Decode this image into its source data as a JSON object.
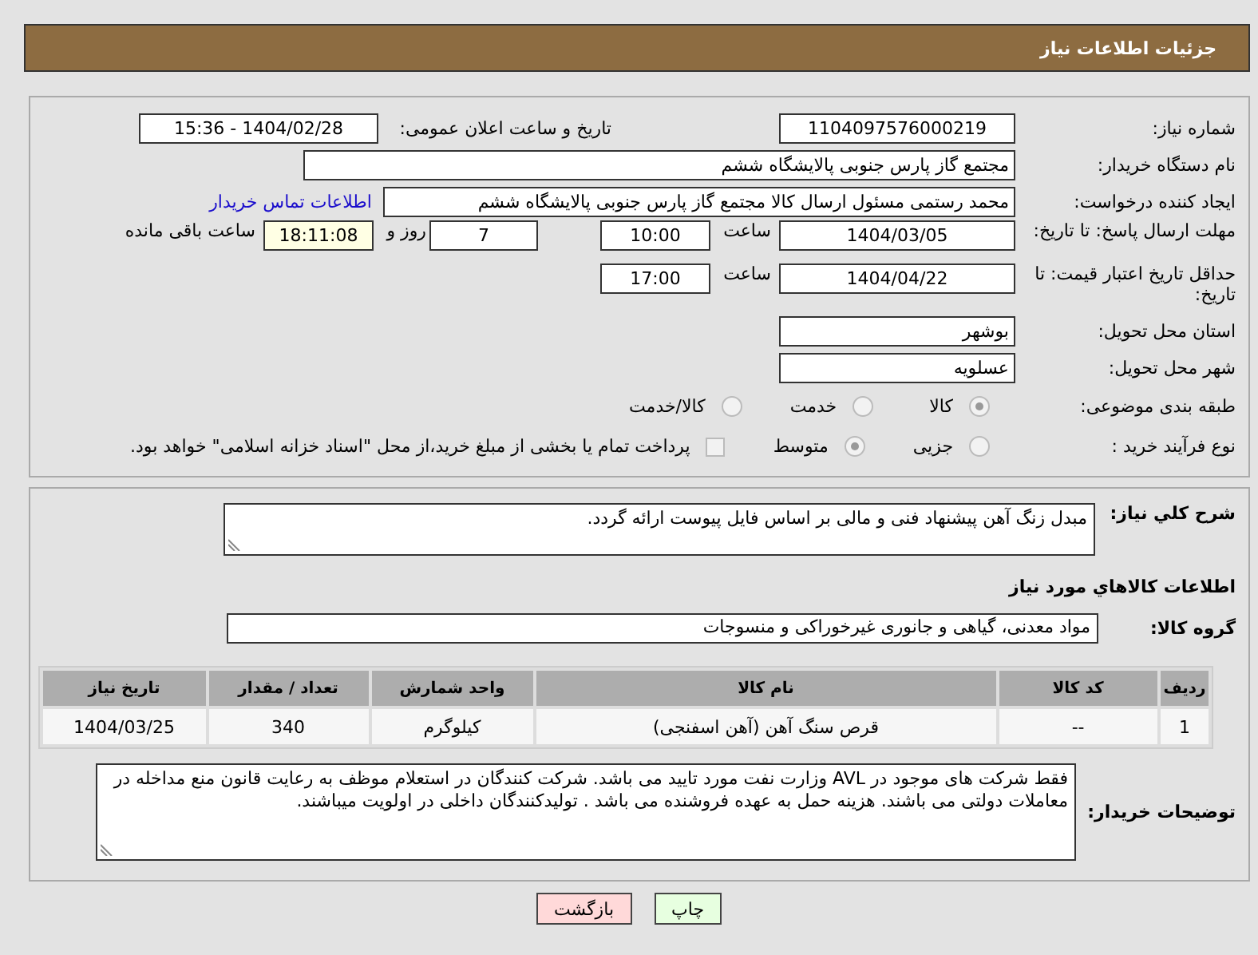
{
  "header": {
    "title": "جزئیات اطلاعات نیاز"
  },
  "need_number": {
    "label": "شماره نیاز:",
    "value": "1104097576000219"
  },
  "announce": {
    "label": "تاریخ و ساعت اعلان عمومی:",
    "value": "1404/02/28 - 15:36"
  },
  "buyer_org": {
    "label": "نام دستگاه خریدار:",
    "value": "مجتمع گاز پارس جنوبی  پالایشگاه ششم"
  },
  "requester": {
    "label": "ایجاد کننده درخواست:",
    "value": "محمد رستمی مسئول ارسال کالا مجتمع گاز پارس جنوبی  پالایشگاه ششم",
    "link": "اطلاعات تماس خریدار"
  },
  "reply_deadline": {
    "label": "مهلت ارسال پاسخ: تا تاریخ:",
    "date": "1404/03/05",
    "time_label": "ساعت",
    "time": "10:00",
    "days": "7",
    "days_label": "روز و",
    "remaining": "18:11:08",
    "remaining_label": "ساعت باقی مانده"
  },
  "price_validity": {
    "label": "حداقل تاریخ اعتبار قیمت: تا تاریخ:",
    "date": "1404/04/22",
    "time_label": "ساعت",
    "time": "17:00"
  },
  "province": {
    "label": "استان محل تحویل:",
    "value": "بوشهر"
  },
  "city": {
    "label": "شهر محل تحویل:",
    "value": "عسلویه"
  },
  "category": {
    "label": "طبقه بندی موضوعی:",
    "options": [
      {
        "label": "کالا",
        "selected": true
      },
      {
        "label": "خدمت",
        "selected": false
      },
      {
        "label": "کالا/خدمت",
        "selected": false
      }
    ]
  },
  "process": {
    "label": "نوع فرآیند خرید :",
    "options": [
      {
        "label": "جزیی",
        "selected": false
      },
      {
        "label": "متوسط",
        "selected": true
      }
    ],
    "payment": {
      "checked": false,
      "text": "پرداخت تمام یا بخشی از مبلغ خرید،از محل \"اسناد خزانه اسلامی\" خواهد بود."
    }
  },
  "summary": {
    "label": "شرح کلي نیاز:",
    "value": "مبدل زنگ آهن پیشنهاد فنی و مالی بر اساس فایل پیوست ارائه گردد."
  },
  "goods_heading": "اطلاعات کالاهاي مورد نیاز",
  "goods_group": {
    "label": "گروه کالا:",
    "value": "مواد معدنی، گیاهی و جانوری غیرخوراکی و منسوجات"
  },
  "table": {
    "columns": [
      "ردیف",
      "کد کالا",
      "نام کالا",
      "واحد شمارش",
      "تعداد / مقدار",
      "تاریخ نیاز"
    ],
    "rows": [
      [
        "1",
        "--",
        "قرص سنگ آهن (آهن اسفنجی)",
        "کیلوگرم",
        "340",
        "1404/03/25"
      ]
    ]
  },
  "buyer_notes": {
    "label": "توضیحات خریدار:",
    "value": "فقط شرکت های موجود در AVL وزارت نفت مورد تایید می باشد. شرکت کنندگان در استعلام موظف به رعایت قانون منع مداخله در معاملات دولتی می باشند. هزینه حمل به عهده فروشنده می باشد . تولیدکنندگان داخلی در اولویت میباشند."
  },
  "buttons": [
    {
      "label": "چاپ",
      "kind": "print"
    },
    {
      "label": "بازگشت",
      "kind": "back"
    }
  ]
}
